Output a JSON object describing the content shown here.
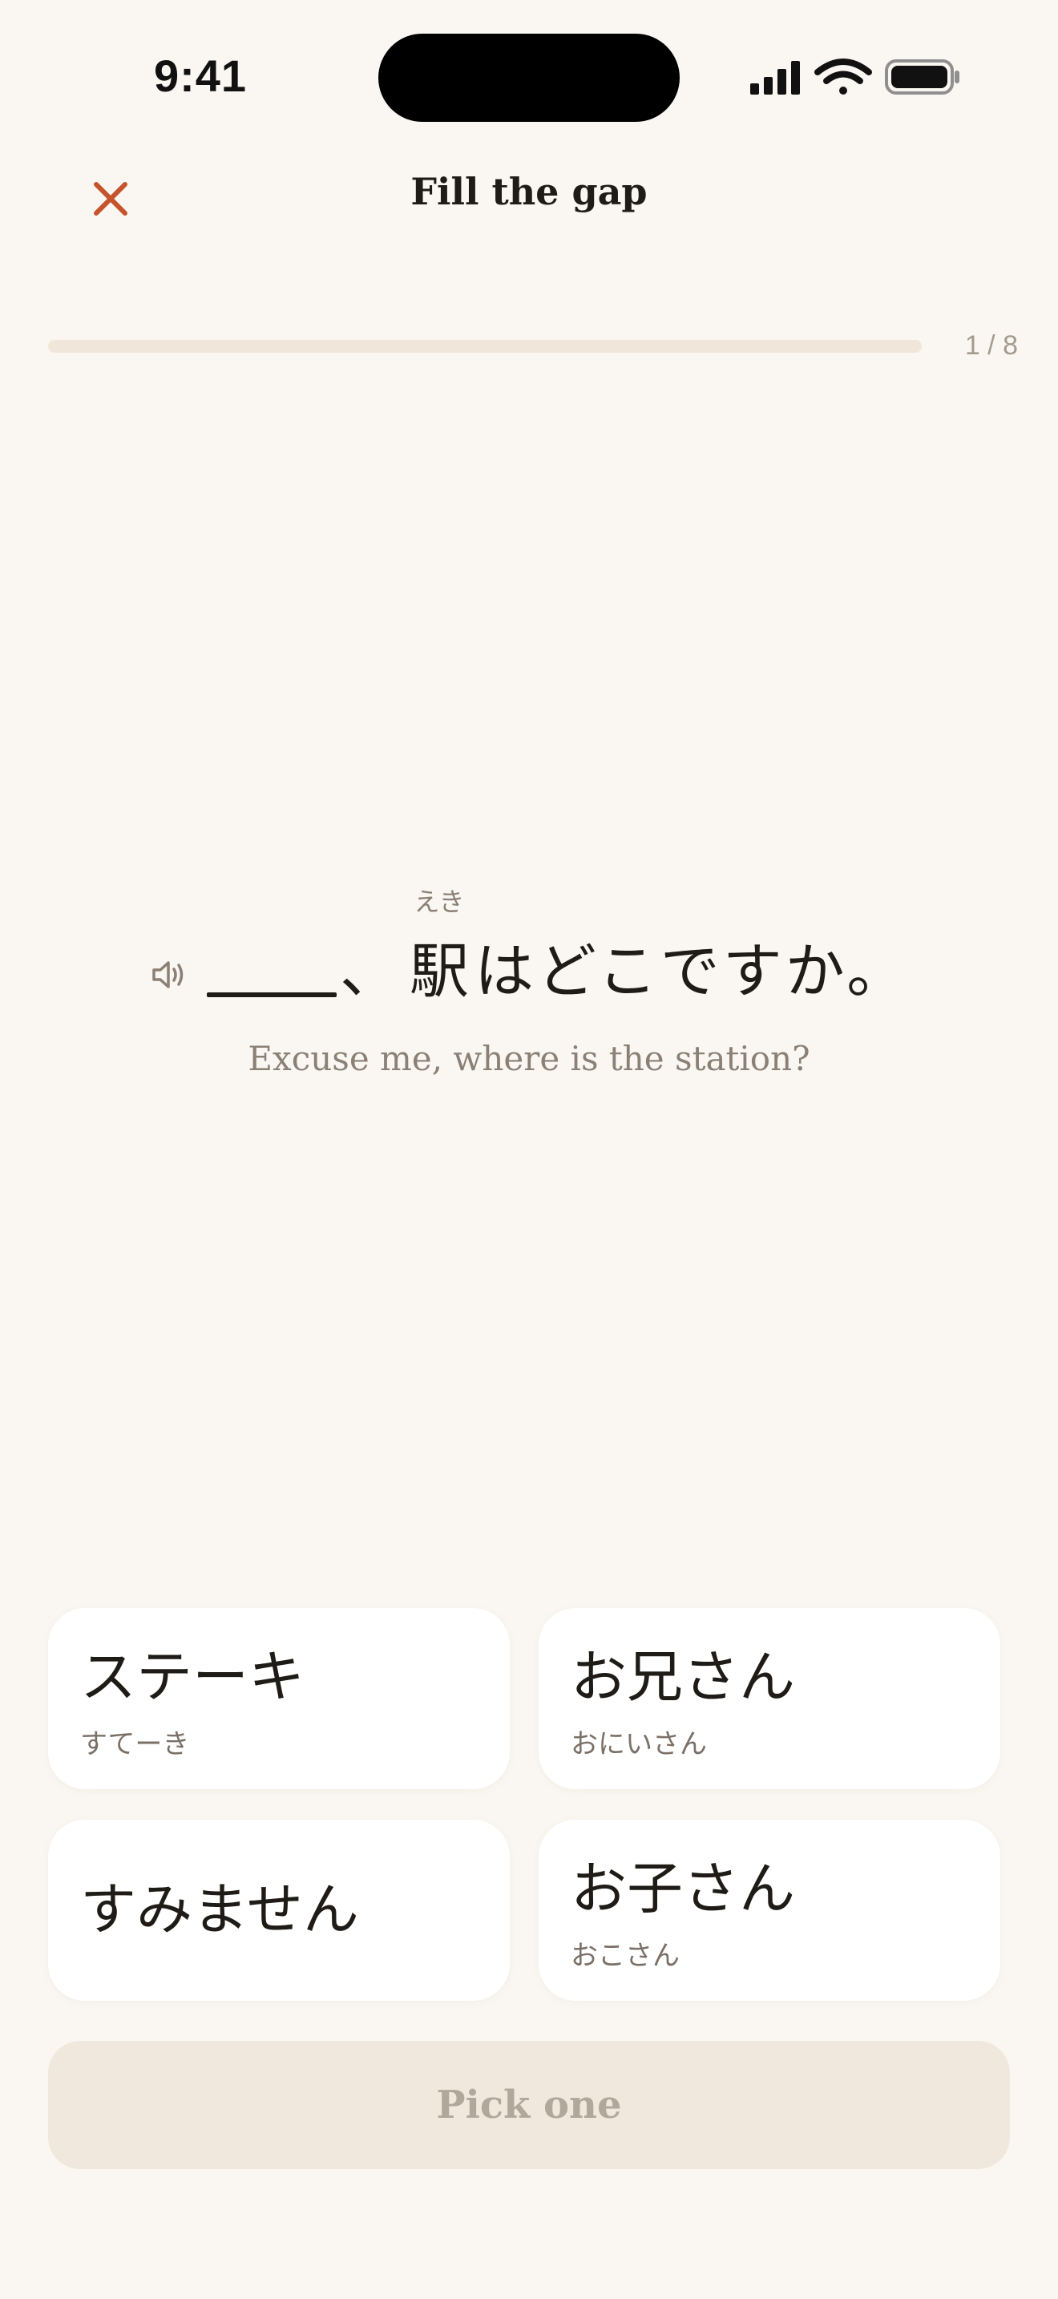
{
  "status_bar": {
    "time": "9:41",
    "icons": [
      "cellular-signal-icon",
      "wifi-icon",
      "battery-icon"
    ]
  },
  "header": {
    "title": "Fill the gap",
    "close_icon": "close-icon"
  },
  "progress": {
    "current": 1,
    "total": 8,
    "label": "1 / 8",
    "fraction": 0
  },
  "exercise": {
    "audio_icon": "speaker-icon",
    "comma": "、",
    "furigana": "えき",
    "kanji": "駅",
    "rest": "はどこですか。",
    "translation": "Excuse me, where is the station?"
  },
  "options": [
    {
      "text": "ステーキ",
      "reading": "すてーき"
    },
    {
      "text": "お兄さん",
      "reading": "おにいさん"
    },
    {
      "text": "すみません",
      "reading": ""
    },
    {
      "text": "お子さん",
      "reading": "おこさん"
    }
  ],
  "action": {
    "label": "Pick one"
  },
  "colors": {
    "background": "#faf7f2",
    "accent": "#c5542d",
    "track": "#f0e6d9",
    "card": "#ffffff",
    "button_disabled": "#f0e8dc"
  }
}
